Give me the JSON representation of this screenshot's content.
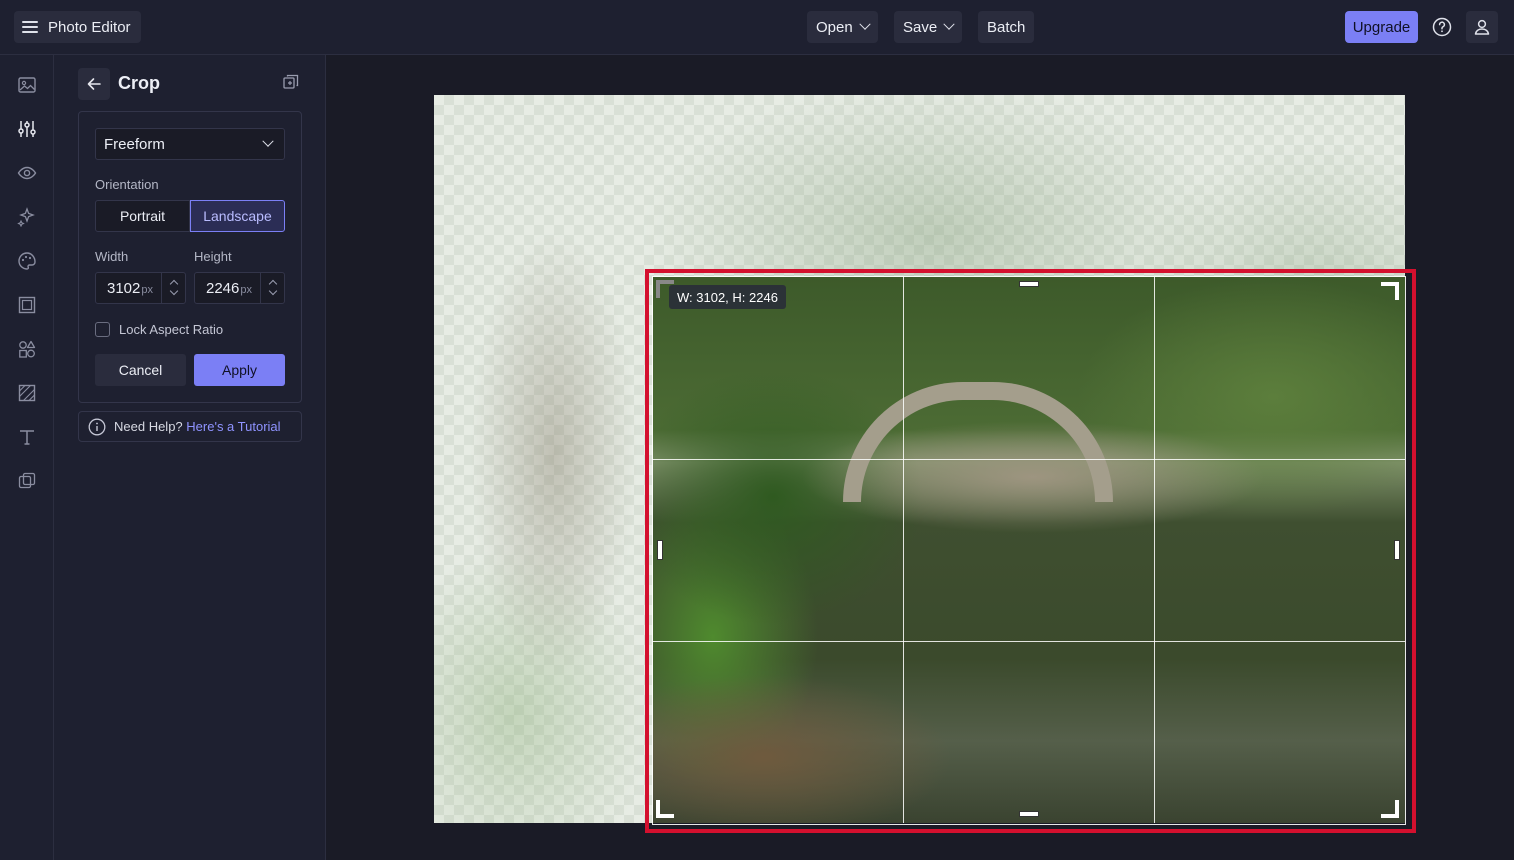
{
  "app": {
    "title": "Photo Editor"
  },
  "menu": {
    "open": "Open",
    "save": "Save",
    "batch": "Batch",
    "upgrade": "Upgrade"
  },
  "panel": {
    "title": "Crop",
    "ratio_select": "Freeform",
    "orientation_label": "Orientation",
    "orientation_options": [
      "Portrait",
      "Landscape"
    ],
    "orientation_selected": "Landscape",
    "width_label": "Width",
    "height_label": "Height",
    "width_value": "3102",
    "height_value": "2246",
    "unit": "px",
    "lock_label": "Lock Aspect Ratio",
    "lock_checked": false,
    "cancel": "Cancel",
    "apply": "Apply",
    "help_text": "Need Help?",
    "help_link": "Here's a Tutorial"
  },
  "canvas": {
    "dimensions_badge": "W: 3102, H: 2246"
  },
  "colors": {
    "accent": "#7b7ff5",
    "crop_frame": "#d4102e",
    "background": "#1a1b26"
  },
  "rail_icons": [
    "image-icon",
    "adjust-sliders-icon",
    "eye-icon",
    "sparkle-effects-icon",
    "palette-icon",
    "frame-icon",
    "elements-icon",
    "texture-icon",
    "text-icon",
    "overlay-icon"
  ]
}
